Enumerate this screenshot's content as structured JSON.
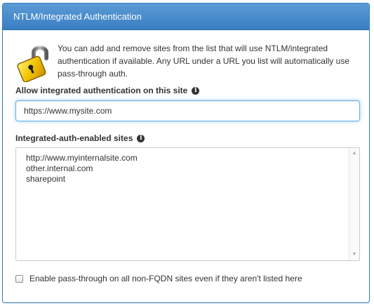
{
  "panel": {
    "title": "NTLM/Integrated Authentication",
    "header_color": "#428bca",
    "icon": "padlock-icon"
  },
  "intro": {
    "text": "You can add and remove sites from the list that will use NTLM/integrated authentication if available. Any URL under a URL you list will automatically use pass-through auth."
  },
  "site_field": {
    "label": "Allow integrated authentication on this site",
    "info_icon": "info-icon",
    "value": "https://www.mysite.com"
  },
  "sites": {
    "label": "Integrated-auth-enabled sites",
    "info_icon": "info-icon",
    "items": [
      "http://www.myinternalsite.com",
      "other.internal.com",
      "sharepoint"
    ]
  },
  "non_fqdn": {
    "label": "Enable pass-through on all non-FQDN sites even if they aren't listed here",
    "checked": false
  }
}
